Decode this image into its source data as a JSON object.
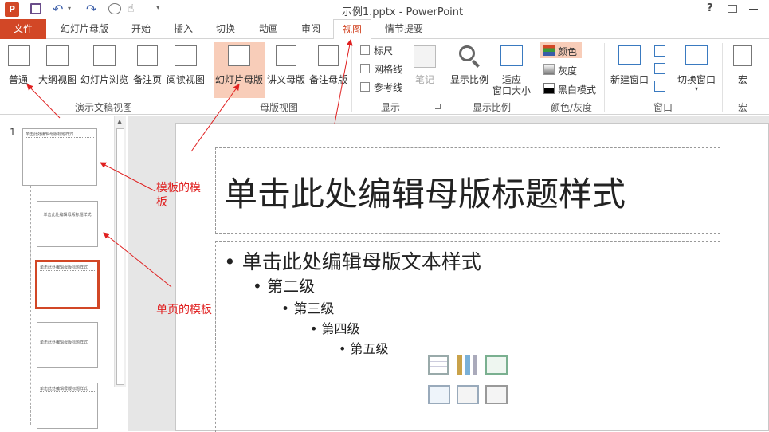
{
  "window": {
    "title": "示例1.pptx - PowerPoint",
    "help": "?"
  },
  "tabs": [
    "文件",
    "幻灯片母版",
    "开始",
    "插入",
    "切换",
    "动画",
    "审阅",
    "视图",
    "情节提要"
  ],
  "ribbon": {
    "presentation_views": {
      "label": "演示文稿视图",
      "buttons": [
        "普通",
        "大纲视图",
        "幻灯片浏览",
        "备注页",
        "阅读视图"
      ]
    },
    "master_views": {
      "label": "母版视图",
      "buttons": [
        "幻灯片母版",
        "讲义母版",
        "备注母版"
      ]
    },
    "show": {
      "label": "显示",
      "items": [
        "标尺",
        "网格线",
        "参考线"
      ],
      "notes": "笔记"
    },
    "zoom": {
      "label": "显示比例",
      "buttons": [
        "显示比例",
        "适应",
        "窗口大小"
      ]
    },
    "color": {
      "label": "颜色/灰度",
      "items": [
        "颜色",
        "灰度",
        "黑白模式"
      ]
    },
    "window": {
      "label": "窗口",
      "buttons": [
        "新建窗口",
        "切换窗口"
      ]
    },
    "macros": {
      "label": "宏",
      "button": "宏"
    }
  },
  "thumbnails": {
    "slide_number": "1",
    "master_title": "单击此处编辑母版标题样式",
    "layout_title": "单击此处编辑母版标题样式"
  },
  "slide": {
    "title": "单击此处编辑母版标题样式",
    "bullets": [
      "单击此处编辑母版文本样式",
      "第二级",
      "第三级",
      "第四级",
      "第五级"
    ]
  },
  "annotations": {
    "template_of_templates": "模板的模板",
    "single_page_template": "单页的模板"
  },
  "colors": {
    "accent": "#d24726",
    "annotation": "#e02020"
  }
}
